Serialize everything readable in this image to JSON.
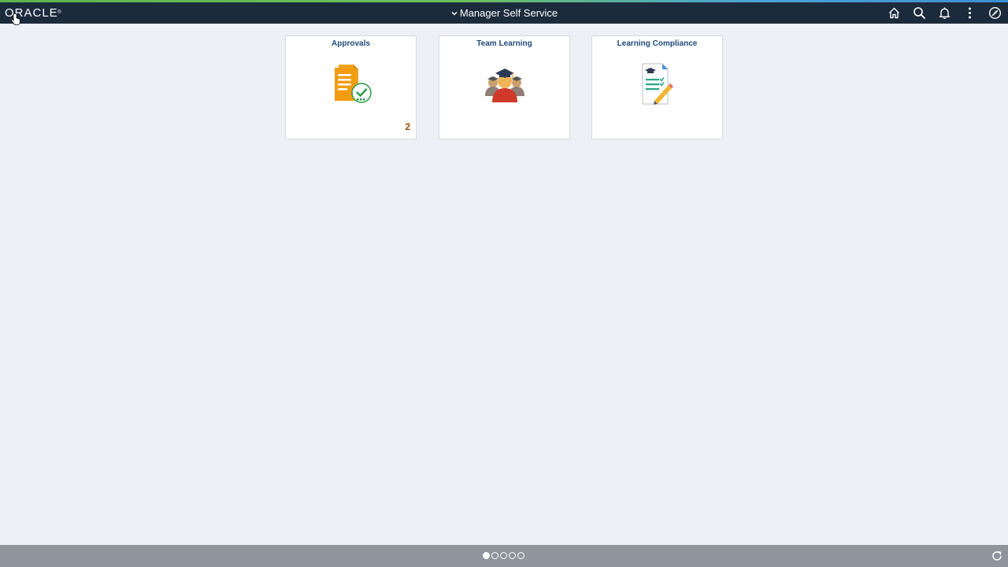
{
  "header": {
    "logo_text": "ORACLE",
    "logo_mark": "®",
    "title": "Manager Self Service",
    "title_icon": "chevron-down-icon",
    "icons": [
      "home-icon",
      "search-icon",
      "bell-icon",
      "more-vertical-icon",
      "navbar-compass-icon"
    ]
  },
  "tiles": [
    {
      "title": "Approvals",
      "icon": "approvals-document-check-icon",
      "badge": "2"
    },
    {
      "title": "Team Learning",
      "icon": "graduates-group-icon",
      "badge": ""
    },
    {
      "title": "Learning Compliance",
      "icon": "compliance-checklist-pencil-icon",
      "badge": ""
    }
  ],
  "footer": {
    "page_count": 5,
    "active_page": 1,
    "refresh_icon": "refresh-icon"
  },
  "colors": {
    "header_bg": "#1c2b3c",
    "page_bg": "#eef0f5",
    "tile_title": "#1e4b7a",
    "badge": "#a24b00",
    "footer_bg": "#8f949d"
  }
}
